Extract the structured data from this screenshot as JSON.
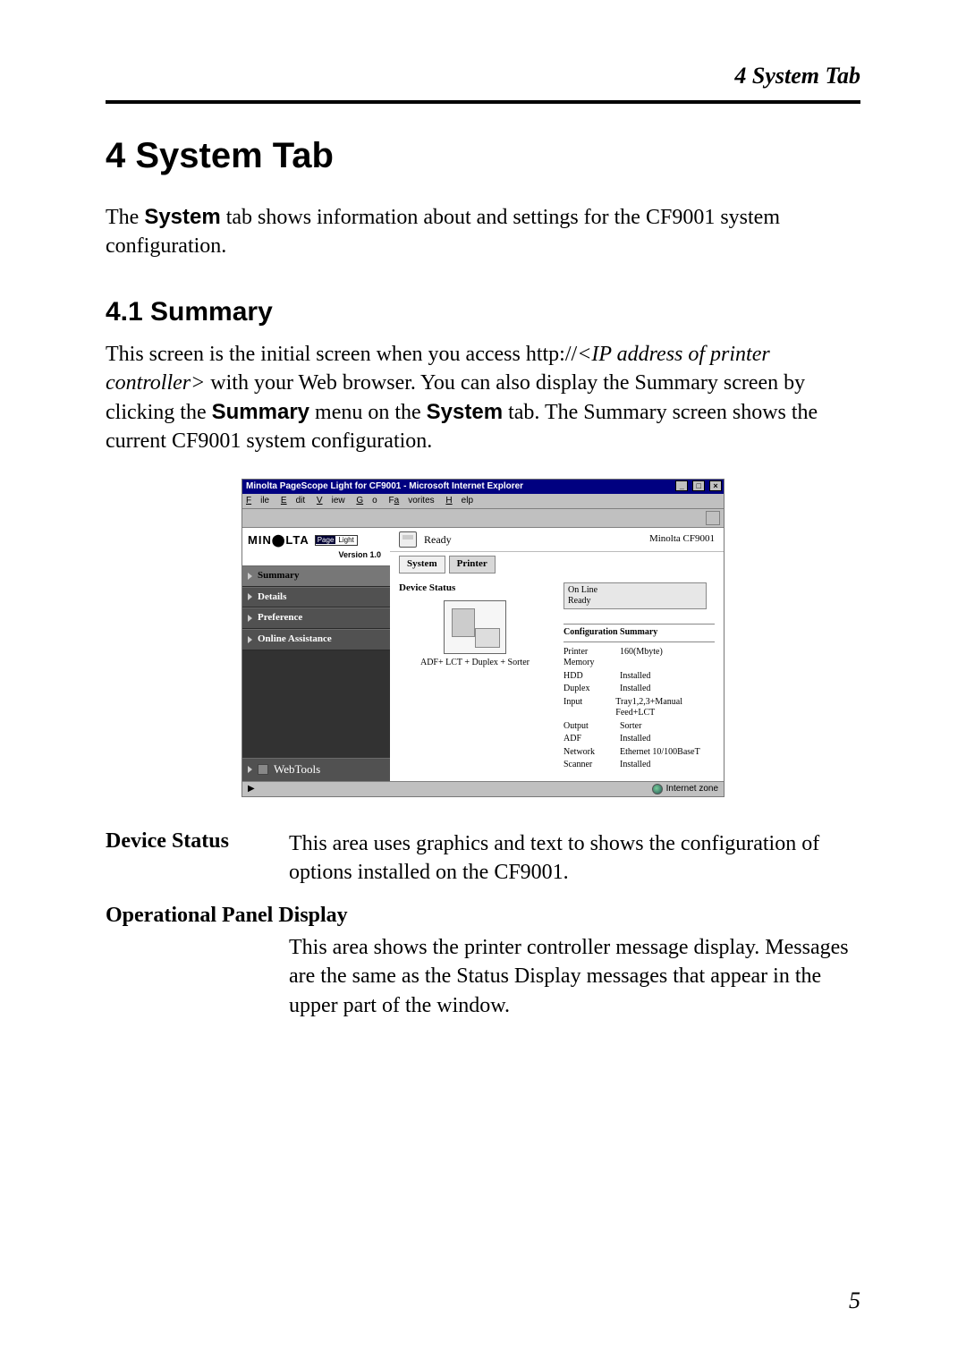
{
  "running_header": "4  System Tab",
  "h1": "4   System Tab",
  "intro_before_bold": "The ",
  "intro_bold": "System",
  "intro_after_bold": " tab shows information about and settings for the CF9001 system configuration.",
  "h2": "4.1   Summary",
  "p2_part1": "This screen is the initial screen when you access http://",
  "p2_italic": "<IP address of printer controller>",
  "p2_part2": " with your Web browser. You can also display the Summary screen by clicking the ",
  "p2_bold1": "Summary",
  "p2_part3": " menu on the ",
  "p2_bold2": "System",
  "p2_part4": " tab. The Summary screen shows the current CF9001 system configuration.",
  "fig": {
    "window_title": "Minolta PageScope Light for CF9001 - Microsoft Internet Explorer",
    "menus": {
      "file": "File",
      "edit": "Edit",
      "view": "View",
      "go": "Go",
      "fav": "Favorites",
      "help": "Help"
    },
    "logo_name": "MIN⬤LTA",
    "badge_left": "Page",
    "badge_right": "Light",
    "version": "Version 1.0",
    "nav": [
      "Summary",
      "Details",
      "Preference",
      "Online Assistance"
    ],
    "webtools": "WebTools",
    "ready": "Ready",
    "model": "Minolta CF9001",
    "tab_system": "System",
    "tab_printer": "Printer",
    "heading_device": "Device Status",
    "device_caption": "ADF+ LCT + Duplex + Sorter",
    "panel_line1": "On Line",
    "panel_line2": "Ready",
    "conf_head": "Configuration Summary",
    "rows": [
      {
        "k": "Printer Memory",
        "v": "160(Mbyte)"
      },
      {
        "k": "HDD",
        "v": "Installed"
      },
      {
        "k": "Duplex",
        "v": "Installed"
      },
      {
        "k": "Input",
        "v": "Tray1,2,3+Manual Feed+LCT"
      },
      {
        "k": "Output",
        "v": "Sorter"
      },
      {
        "k": "ADF",
        "v": "Installed"
      },
      {
        "k": "Network",
        "v": "Ethernet 10/100BaseT"
      },
      {
        "k": "Scanner",
        "v": "Installed"
      }
    ],
    "zone": "Internet zone"
  },
  "def1_term": "Device Status",
  "def1_text": "This area uses graphics and text to shows the configuration of options installed on the CF9001.",
  "def2_term": "Operational Panel Display",
  "def2_text": "This area shows the printer controller message display. Messages are the same as the Status Display messages that appear in the upper part of the window.",
  "page_number": "5"
}
